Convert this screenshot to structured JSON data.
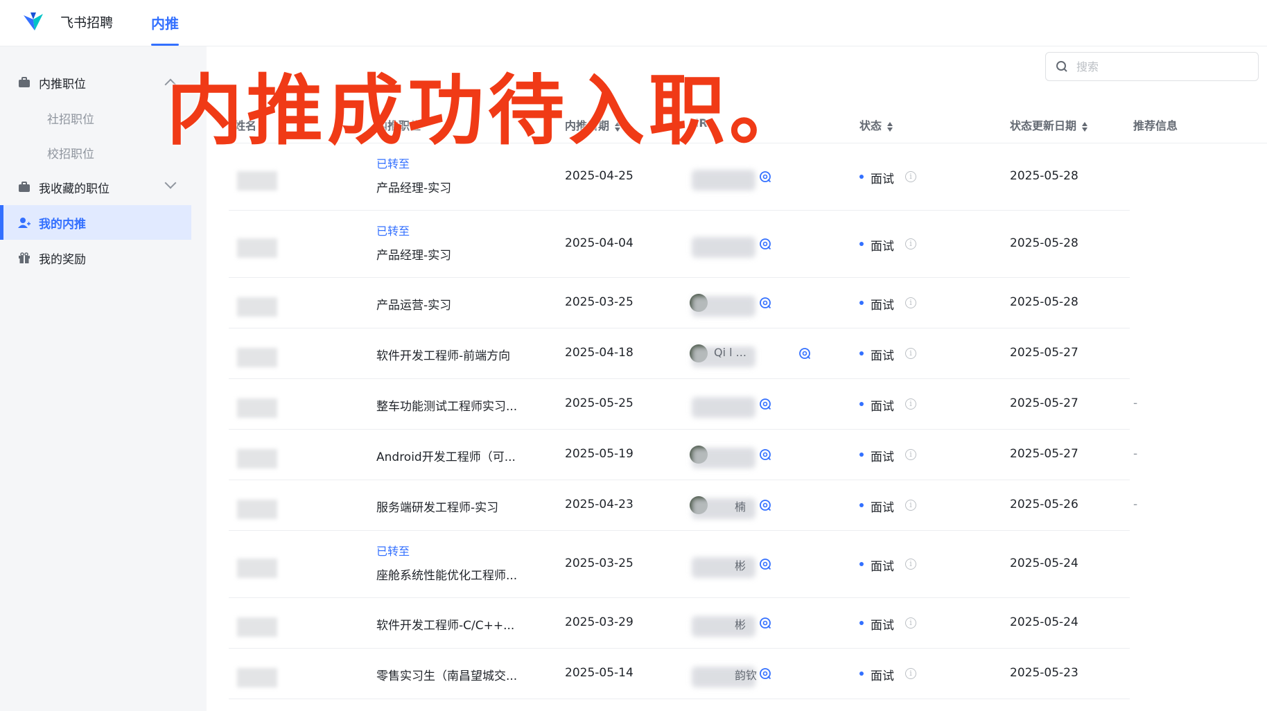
{
  "header": {
    "brand": "飞书招聘",
    "tab": "内推",
    "brand_color": "#3370ff"
  },
  "sidebar": {
    "items": [
      {
        "label": "内推职位",
        "icon": "briefcase-icon"
      },
      {
        "label": "社招职位"
      },
      {
        "label": "校招职位"
      },
      {
        "label": "我收藏的职位",
        "icon": "briefcase-icon"
      },
      {
        "label": "我的内推",
        "icon": "user-add-icon",
        "active": true
      },
      {
        "label": "我的奖励",
        "icon": "gift-icon"
      }
    ]
  },
  "search": {
    "placeholder": "搜索"
  },
  "overlay_caption": "内推成功待入职。",
  "table": {
    "headers": {
      "name": "姓名",
      "job": "内推职位",
      "date": "内推日期",
      "hr": "HR",
      "status": "状态",
      "updated": "状态更新日期",
      "info": "推荐信息"
    },
    "rows": [
      {
        "transfer": "已转至",
        "job": "产品经理-实习",
        "date": "2025-04-25",
        "hr": "",
        "status": "面试",
        "updated": "2025-05-28",
        "info": ""
      },
      {
        "transfer": "已转至",
        "job": "产品经理-实习",
        "date": "2025-04-04",
        "hr": "",
        "status": "面试",
        "updated": "2025-05-28",
        "info": ""
      },
      {
        "transfer": "",
        "job": "产品运营-实习",
        "date": "2025-03-25",
        "hr": "",
        "status": "面试",
        "updated": "2025-05-28",
        "info": ""
      },
      {
        "transfer": "",
        "job": "软件开发工程师-前端方向",
        "date": "2025-04-18",
        "hr": "Qi l ...",
        "status": "面试",
        "updated": "2025-05-27",
        "info": ""
      },
      {
        "transfer": "",
        "job": "整车功能测试工程师实习...",
        "date": "2025-05-25",
        "hr": "",
        "status": "面试",
        "updated": "2025-05-27",
        "info": "-"
      },
      {
        "transfer": "",
        "job": "Android开发工程师（可...",
        "date": "2025-05-19",
        "hr": "",
        "status": "面试",
        "updated": "2025-05-27",
        "info": "-"
      },
      {
        "transfer": "",
        "job": "服务端研发工程师-实习",
        "date": "2025-04-23",
        "hr": "楠",
        "status": "面试",
        "updated": "2025-05-26",
        "info": "-"
      },
      {
        "transfer": "已转至",
        "job": "座舱系统性能优化工程师...",
        "date": "2025-03-25",
        "hr": "彬",
        "status": "面试",
        "updated": "2025-05-24",
        "info": ""
      },
      {
        "transfer": "",
        "job": "软件开发工程师-C/C++...",
        "date": "2025-03-29",
        "hr": "彬",
        "status": "面试",
        "updated": "2025-05-24",
        "info": ""
      },
      {
        "transfer": "",
        "job": "零售实习生（南昌望城交...",
        "date": "2025-05-14",
        "hr": "韵钦",
        "status": "面试",
        "updated": "2025-05-23",
        "info": ""
      }
    ]
  }
}
